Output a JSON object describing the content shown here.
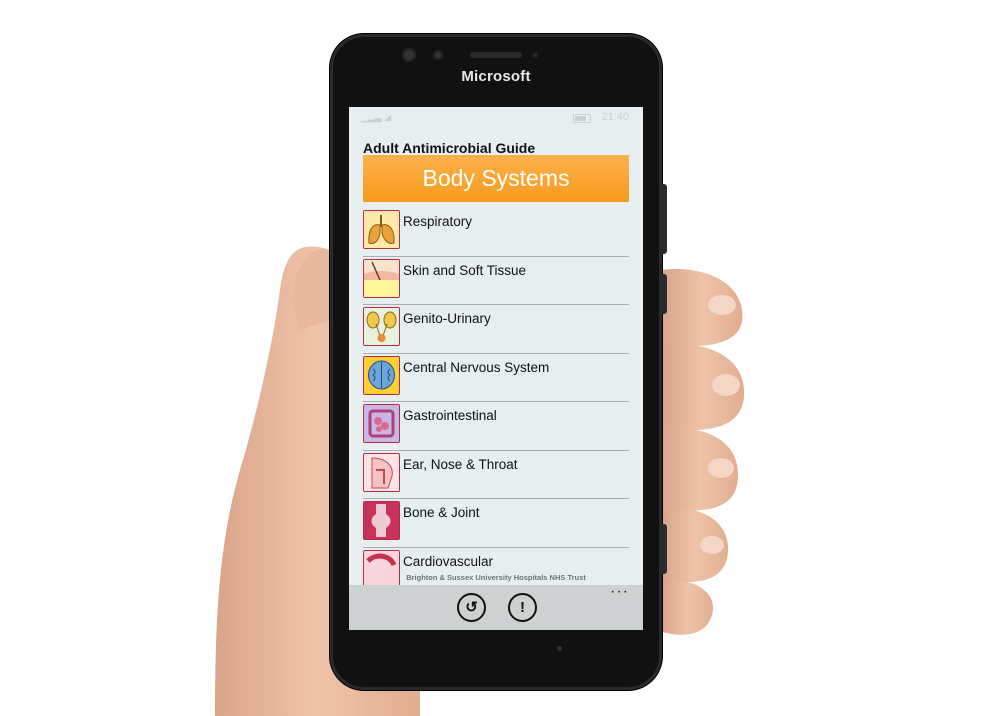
{
  "device": {
    "brand": "Microsoft"
  },
  "statusbar": {
    "signal": "▁▂▃ ◢",
    "time": "21:40"
  },
  "app": {
    "title": "Adult Antimicrobial Guide",
    "banner": "Body Systems",
    "banner_colors": {
      "top": "#fbb24a",
      "bottom": "#f79a1e"
    },
    "items": [
      {
        "label": "Respiratory",
        "icon": "lungs-icon"
      },
      {
        "label": "Skin and Soft Tissue",
        "icon": "skin-icon"
      },
      {
        "label": "Genito-Urinary",
        "icon": "kidneys-icon"
      },
      {
        "label": "Central Nervous System",
        "icon": "brain-icon"
      },
      {
        "label": "Gastrointestinal",
        "icon": "intestines-icon"
      },
      {
        "label": "Ear, Nose & Throat",
        "icon": "ent-icon"
      },
      {
        "label": "Bone & Joint",
        "icon": "joint-icon"
      },
      {
        "label": "Cardiovascular",
        "icon": "heart-icon"
      }
    ],
    "footer": "Brighton & Sussex University Hospitals NHS Trust"
  },
  "appbar": {
    "back_glyph": "↺",
    "info_glyph": "!",
    "more_glyph": "···"
  }
}
